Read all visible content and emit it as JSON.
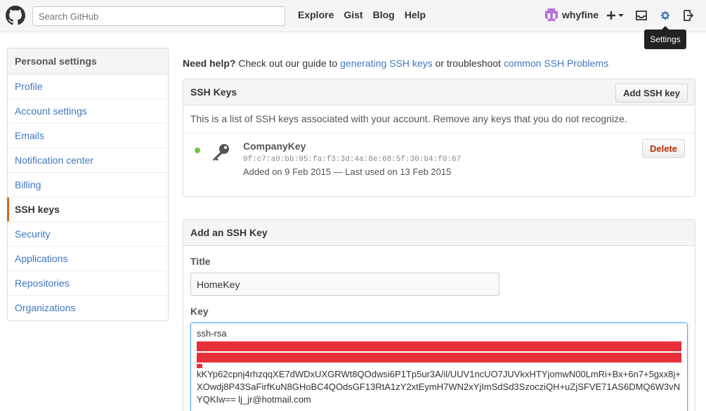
{
  "header": {
    "search_placeholder": "Search GitHub",
    "nav": [
      "Explore",
      "Gist",
      "Blog",
      "Help"
    ],
    "username": "whyfine",
    "settings_tooltip": "Settings"
  },
  "sidebar": {
    "heading": "Personal settings",
    "items": [
      {
        "label": "Profile"
      },
      {
        "label": "Account settings"
      },
      {
        "label": "Emails"
      },
      {
        "label": "Notification center"
      },
      {
        "label": "Billing"
      },
      {
        "label": "SSH keys",
        "active": true
      },
      {
        "label": "Security"
      },
      {
        "label": "Applications"
      },
      {
        "label": "Repositories"
      },
      {
        "label": "Organizations"
      }
    ]
  },
  "help": {
    "bold": "Need help?",
    "text1": " Check out our guide to ",
    "link1": "generating SSH keys",
    "text2": " or troubleshoot ",
    "link2": "common SSH Problems"
  },
  "ssh_keys": {
    "title": "SSH Keys",
    "add_button": "Add SSH key",
    "description": "This is a list of SSH keys associated with your account. Remove any keys that you do not recognize.",
    "key": {
      "name": "CompanyKey",
      "fingerprint": "9f:c7:a0:bb:95:fa:f3:3d:4a:8e:68:5f:30:b4:f0:67",
      "added": "Added on 9 Feb 2015 — Last used on 13 Feb 2015",
      "delete_label": "Delete"
    }
  },
  "add_key": {
    "title": "Add an SSH Key",
    "title_label": "Title",
    "title_value": "HomeKey",
    "key_label": "Key",
    "key_prefix": "ssh-rsa",
    "key_line1": "kKYp62cpnj4rhzqqXE7dWDxUXGRWt8QOdwsi6P1Tp5ur3A/il/UUV1ncUO7JUVkxHTYjomwN00LmRi+Bx+6n7+5gxx8j+",
    "key_line2": "XOwdj8P43SaFirfKuN8GHoBC4QOdsGF13RtA1zY2xtEymH7WN2xYjImSdSd3SzocziQH+uZjSFVE71AS6DMQ6W3vN",
    "key_line3": "YQKIw== lj_jr@hotmail.com"
  },
  "colors": {
    "link": "#4078c0",
    "active_marker": "#d26911",
    "status_dot": "#6cc644",
    "delete_text": "#bd2c00",
    "redaction": "#e8303a"
  }
}
